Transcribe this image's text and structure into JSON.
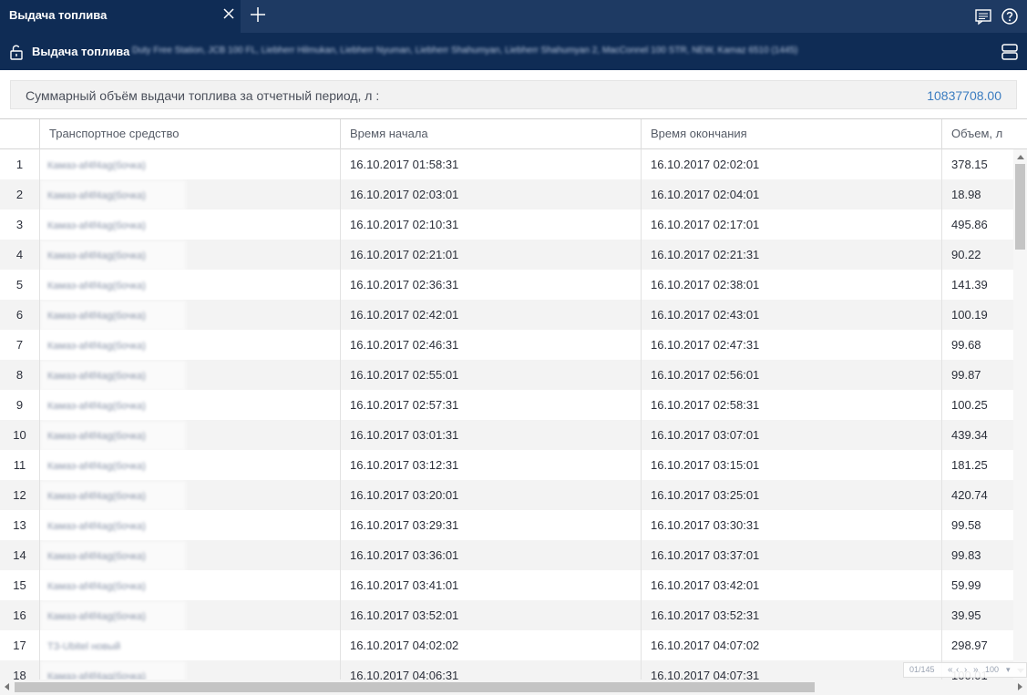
{
  "tab": {
    "title": "Выдача топлива"
  },
  "subheader": {
    "title": "Выдача топлива",
    "filter_text": "Duty Free Station, JCB 100 FL, Liebherr Hilmukan, Liebherr Nyuman, Liebherr Shahumyan, Liebherr Shahumyan 2, MacConnel 100 STR, NEW, Kamaz 6510 (1445)"
  },
  "summary": {
    "label": "Суммарный объём выдачи топлива за отчетный период, л :",
    "value": "10837708.00"
  },
  "columns": [
    "Транспортное средство",
    "Время начала",
    "Время окончания",
    "Объем, л"
  ],
  "rows": [
    {
      "n": "1",
      "vehicle": "Камаз-af4f4ag(бочка)",
      "start": "16.10.2017 01:58:31",
      "end": "16.10.2017 02:02:01",
      "volume": "378.15"
    },
    {
      "n": "2",
      "vehicle": "Камаз-af4f4ag(бочка)",
      "start": "16.10.2017 02:03:01",
      "end": "16.10.2017 02:04:01",
      "volume": "18.98"
    },
    {
      "n": "3",
      "vehicle": "Камаз-af4f4ag(бочка)",
      "start": "16.10.2017 02:10:31",
      "end": "16.10.2017 02:17:01",
      "volume": "495.86"
    },
    {
      "n": "4",
      "vehicle": "Камаз-af4f4ag(бочка)",
      "start": "16.10.2017 02:21:01",
      "end": "16.10.2017 02:21:31",
      "volume": "90.22"
    },
    {
      "n": "5",
      "vehicle": "Камаз-af4f4ag(бочка)",
      "start": "16.10.2017 02:36:31",
      "end": "16.10.2017 02:38:01",
      "volume": "141.39"
    },
    {
      "n": "6",
      "vehicle": "Камаз-af4f4ag(бочка)",
      "start": "16.10.2017 02:42:01",
      "end": "16.10.2017 02:43:01",
      "volume": "100.19"
    },
    {
      "n": "7",
      "vehicle": "Камаз-af4f4ag(бочка)",
      "start": "16.10.2017 02:46:31",
      "end": "16.10.2017 02:47:31",
      "volume": "99.68"
    },
    {
      "n": "8",
      "vehicle": "Камаз-af4f4ag(бочка)",
      "start": "16.10.2017 02:55:01",
      "end": "16.10.2017 02:56:01",
      "volume": "99.87"
    },
    {
      "n": "9",
      "vehicle": "Камаз-af4f4ag(бочка)",
      "start": "16.10.2017 02:57:31",
      "end": "16.10.2017 02:58:31",
      "volume": "100.25"
    },
    {
      "n": "10",
      "vehicle": "Камаз-af4f4ag(бочка)",
      "start": "16.10.2017 03:01:31",
      "end": "16.10.2017 03:07:01",
      "volume": "439.34"
    },
    {
      "n": "11",
      "vehicle": "Камаз-af4f4ag(бочка)",
      "start": "16.10.2017 03:12:31",
      "end": "16.10.2017 03:15:01",
      "volume": "181.25"
    },
    {
      "n": "12",
      "vehicle": "Камаз-af4f4ag(бочка)",
      "start": "16.10.2017 03:20:01",
      "end": "16.10.2017 03:25:01",
      "volume": "420.74"
    },
    {
      "n": "13",
      "vehicle": "Камаз-af4f4ag(бочка)",
      "start": "16.10.2017 03:29:31",
      "end": "16.10.2017 03:30:31",
      "volume": "99.58"
    },
    {
      "n": "14",
      "vehicle": "Камаз-af4f4ag(бочка)",
      "start": "16.10.2017 03:36:01",
      "end": "16.10.2017 03:37:01",
      "volume": "99.83"
    },
    {
      "n": "15",
      "vehicle": "Камаз-af4f4ag(бочка)",
      "start": "16.10.2017 03:41:01",
      "end": "16.10.2017 03:42:01",
      "volume": "59.99"
    },
    {
      "n": "16",
      "vehicle": "Камаз-af4f4ag(бочка)",
      "start": "16.10.2017 03:52:01",
      "end": "16.10.2017 03:52:31",
      "volume": "39.95"
    },
    {
      "n": "17",
      "vehicle": "ТЗ-Ubitel новый",
      "start": "16.10.2017 04:02:02",
      "end": "16.10.2017 04:07:02",
      "volume": "298.97"
    },
    {
      "n": "18",
      "vehicle": "Камаз-af4f4ag(бочка)",
      "start": "16.10.2017 04:06:31",
      "end": "16.10.2017 04:07:31",
      "volume": "100.01"
    }
  ],
  "pager": {
    "position": "01/145",
    "page_size": "100"
  },
  "icons": {
    "tab_close": "close-icon",
    "tab_add": "plus-icon",
    "chat": "chat-icon",
    "help": "help-icon",
    "lock": "unlock-icon",
    "layout": "layout-icon"
  },
  "colors": {
    "tabbar": "#1e3a63",
    "active_tab": "#0f2c55",
    "accent_value": "#3b7cc0",
    "alt_row": "#f3f3f3"
  }
}
